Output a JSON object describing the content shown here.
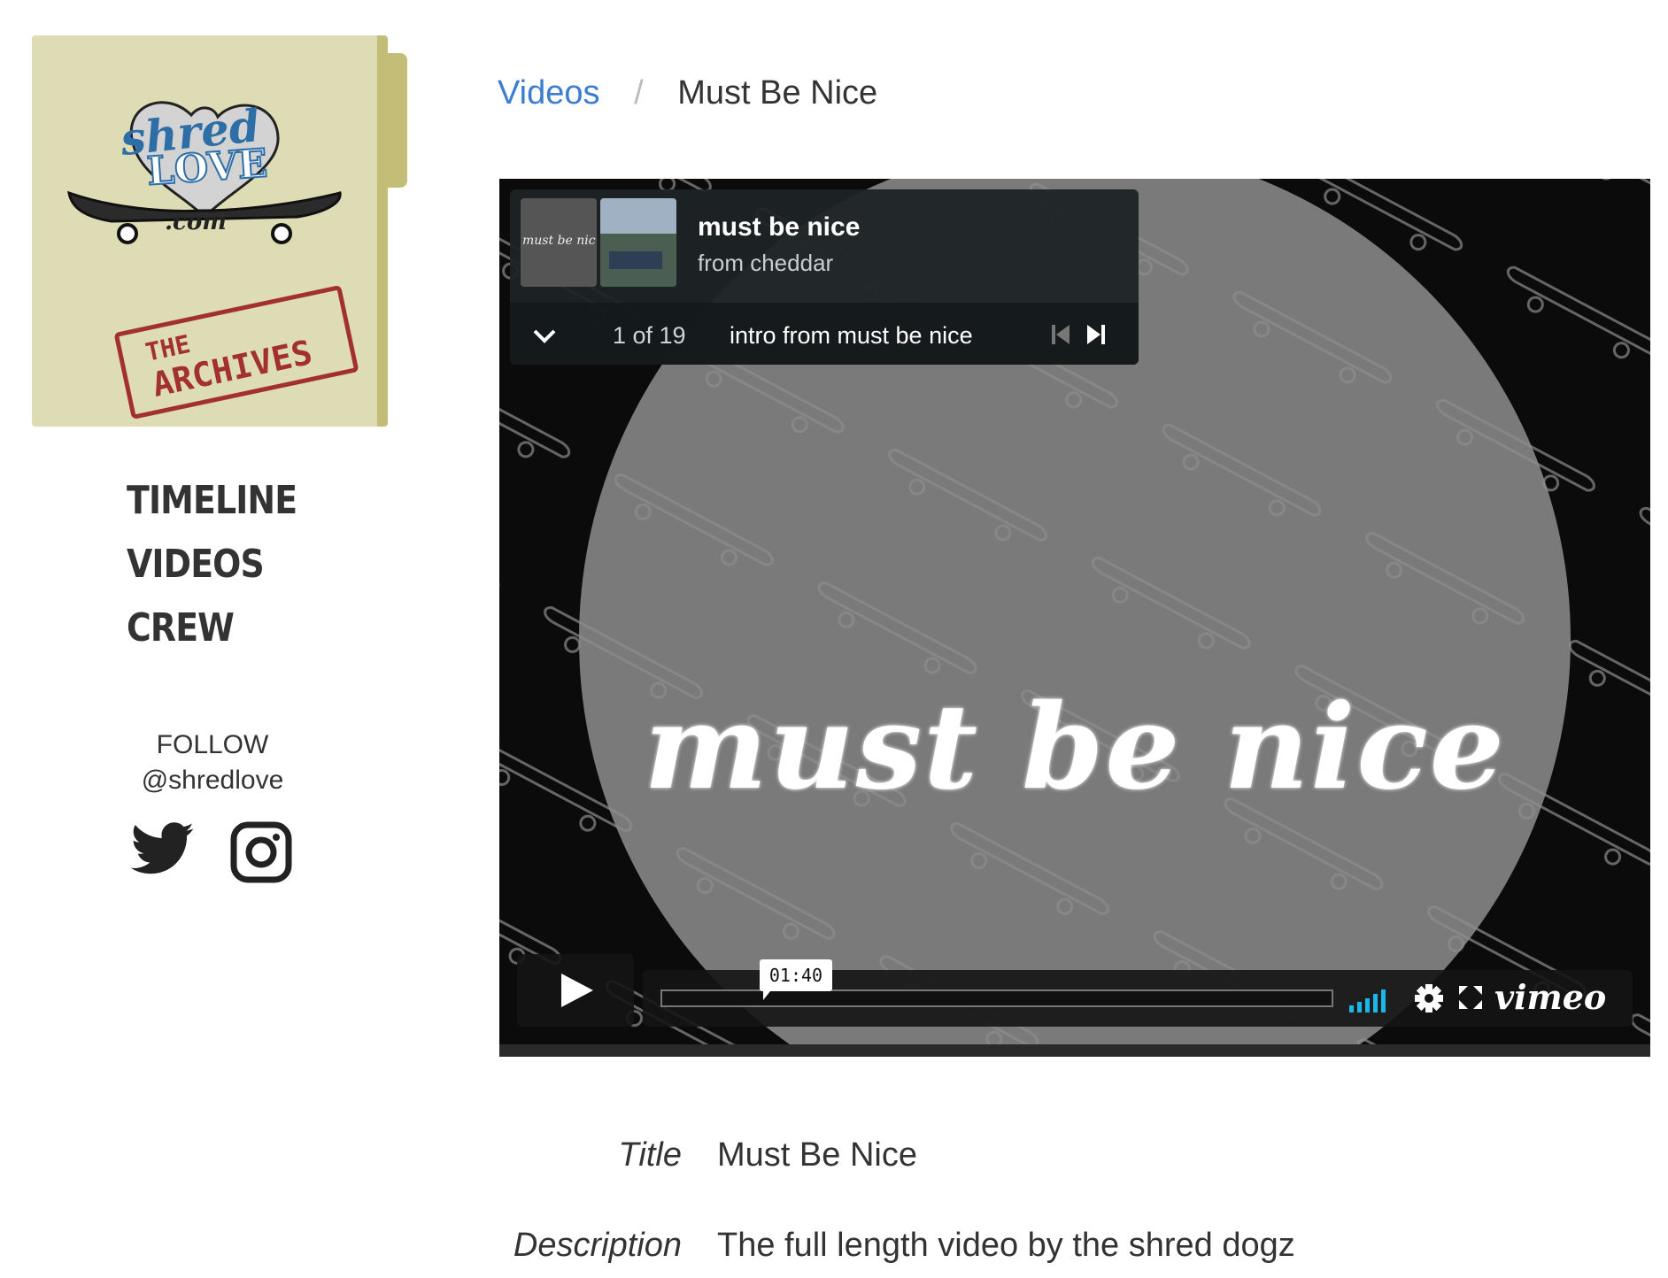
{
  "sidebar": {
    "logo": {
      "word1": "shred",
      "word2": "LOVE",
      "word3": ".com",
      "stamp_line1": "THE",
      "stamp_line2": "ARCHIVES"
    },
    "nav": [
      "TIMELINE",
      "VIDEOS",
      "CREW"
    ],
    "follow_label": "FOLLOW",
    "follow_handle": "@shredlove",
    "social_icons": [
      "twitter-icon",
      "instagram-icon"
    ]
  },
  "breadcrumb": {
    "parent": "Videos",
    "separator": "/",
    "current": "Must Be Nice"
  },
  "player": {
    "overlay_title": "must be nice",
    "info_title": "must be nice",
    "info_subtitle": "from cheddar",
    "thumb_text": "must be nic",
    "position": "1 of 19",
    "clip_title": "intro from must be nice",
    "time": "01:40",
    "brand": "vimeo",
    "progress_fraction": 0.0,
    "colors": {
      "volume": "#1ab7ea",
      "overlay_bg": "#1e2426"
    }
  },
  "details": {
    "title_label": "Title",
    "title_value": "Must Be Nice",
    "description_label": "Description",
    "description_value": "The full length video by the shred dogz"
  }
}
